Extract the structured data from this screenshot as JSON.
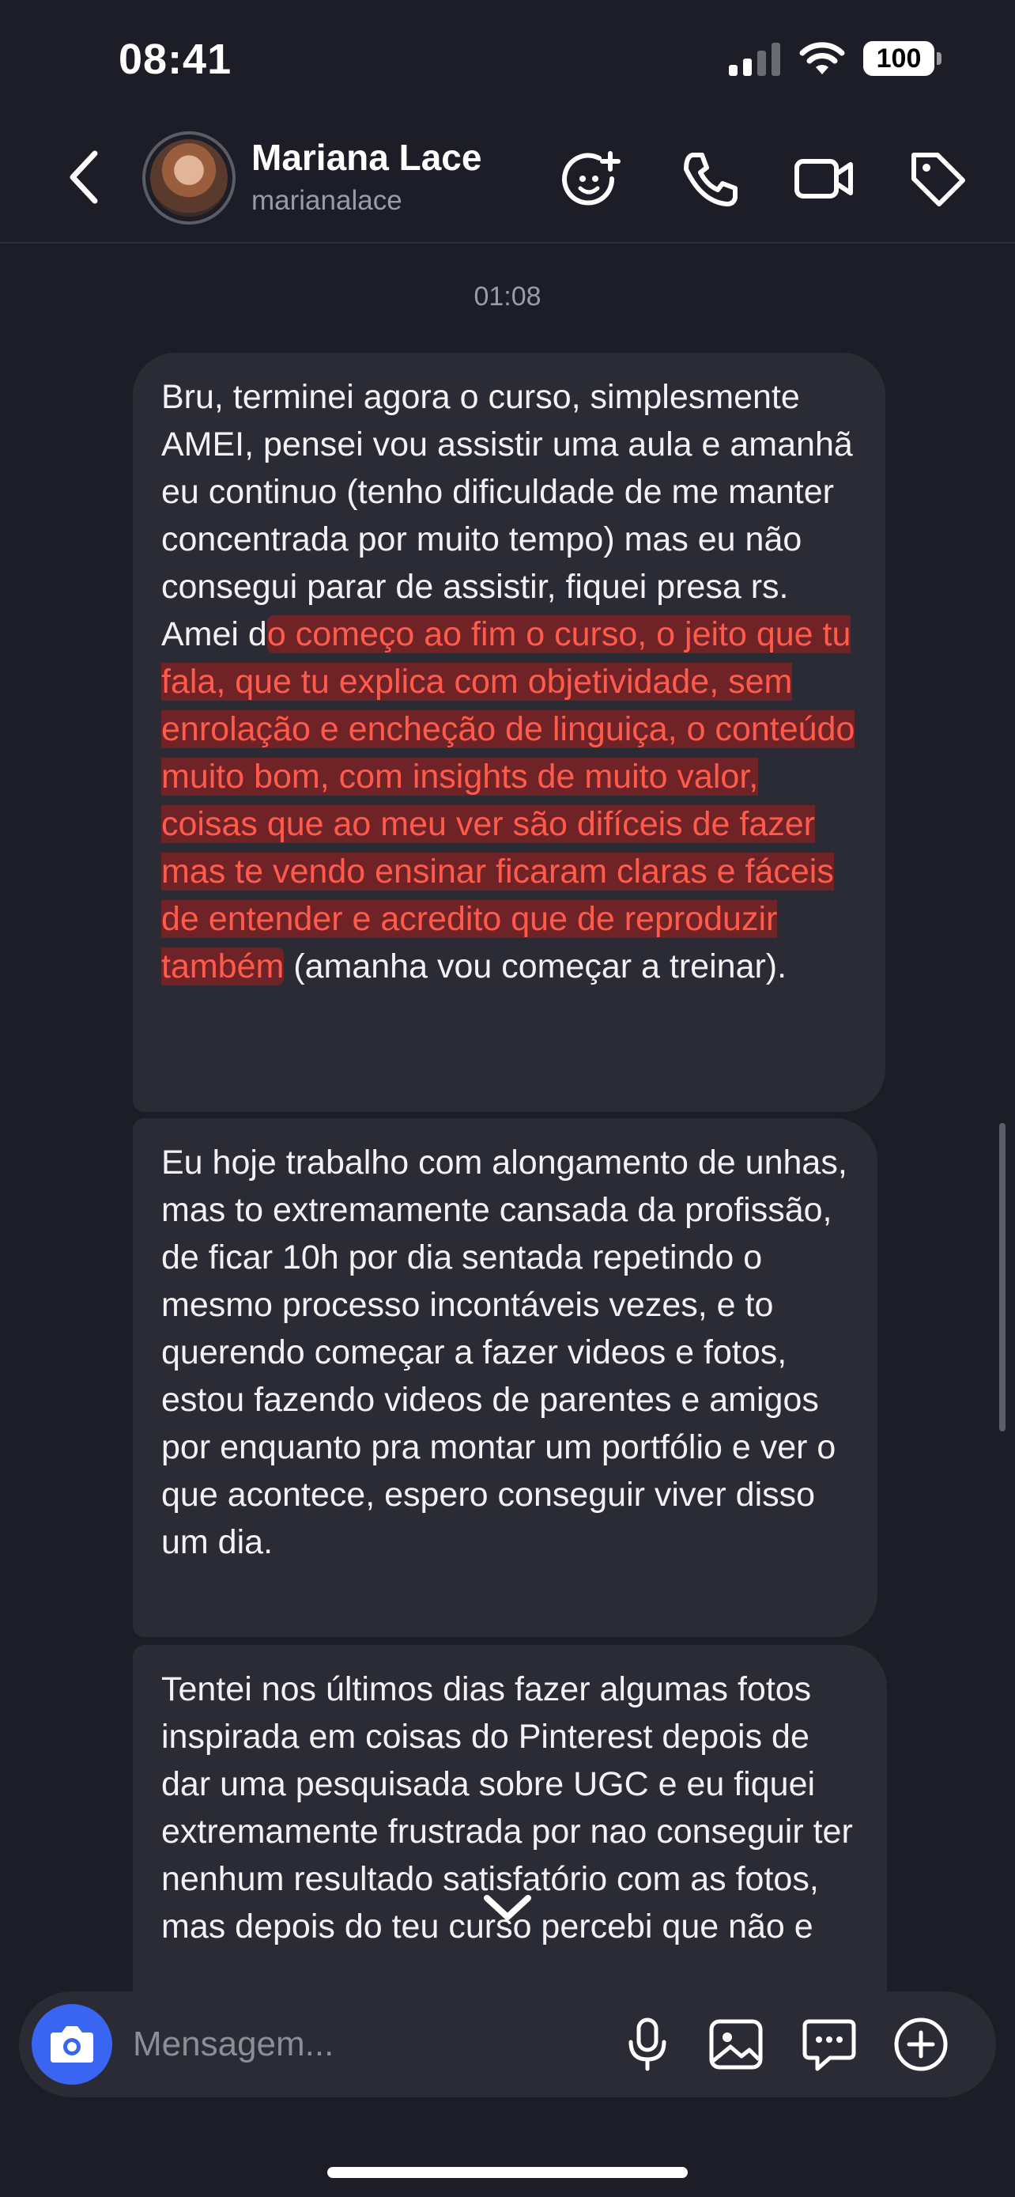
{
  "status_bar": {
    "time": "08:41",
    "battery": "100"
  },
  "header": {
    "name": "Mariana Lace",
    "username": "marianalace"
  },
  "thread": {
    "timestamp": "01:08",
    "messages": [
      {
        "before": "Bru, terminei agora o curso, simplesmente AMEI, pensei vou assistir uma aula e amanhã eu continuo (tenho dificuldade de me manter concentrada por muito tempo) mas eu não consegui parar de assistir, fiquei presa rs. Amei d",
        "highlight": "o começo ao fim o curso, o jeito que tu fala, que tu explica com objetividade, sem enrolação e encheção de linguiça, o conteúdo muito bom, com insights de muito valor,   coisas que ao meu ver são difíceis de fazer mas te vendo ensinar ficaram claras e fáceis de entender e acredito que de reproduzir também",
        "after": " (amanha vou começar a treinar)."
      },
      {
        "text": "Eu hoje trabalho com alongamento de unhas, mas to extremamente cansada da profissão, de ficar 10h por dia sentada repetindo o mesmo processo incontáveis vezes, e to querendo começar a fazer videos e fotos, estou fazendo videos de parentes e amigos por enquanto pra montar um portfólio e ver o que acontece, espero conseguir viver disso um dia."
      },
      {
        "text": "Tentei nos últimos dias fazer algumas fotos inspirada em coisas do Pinterest depois de dar uma pesquisada sobre UGC e eu fiquei extremamente frustrada por nao conseguir ter nenhum resultado satisfatório com as fotos, mas depois do teu curso percebi que não e"
      }
    ]
  },
  "composer": {
    "placeholder": "Mensagem..."
  },
  "colors": {
    "accent": "#3a64f2",
    "highlight": "#ff5a4a",
    "bubble": "#2a2b34",
    "background": "#1c1d26"
  },
  "icons": [
    "chevron-left-icon",
    "sticker-add-icon",
    "phone-icon",
    "video-camera-icon",
    "tag-icon",
    "camera-icon",
    "microphone-icon",
    "image-icon",
    "chat-bubble-icon",
    "plus-circle-icon",
    "chevron-down-icon"
  ]
}
